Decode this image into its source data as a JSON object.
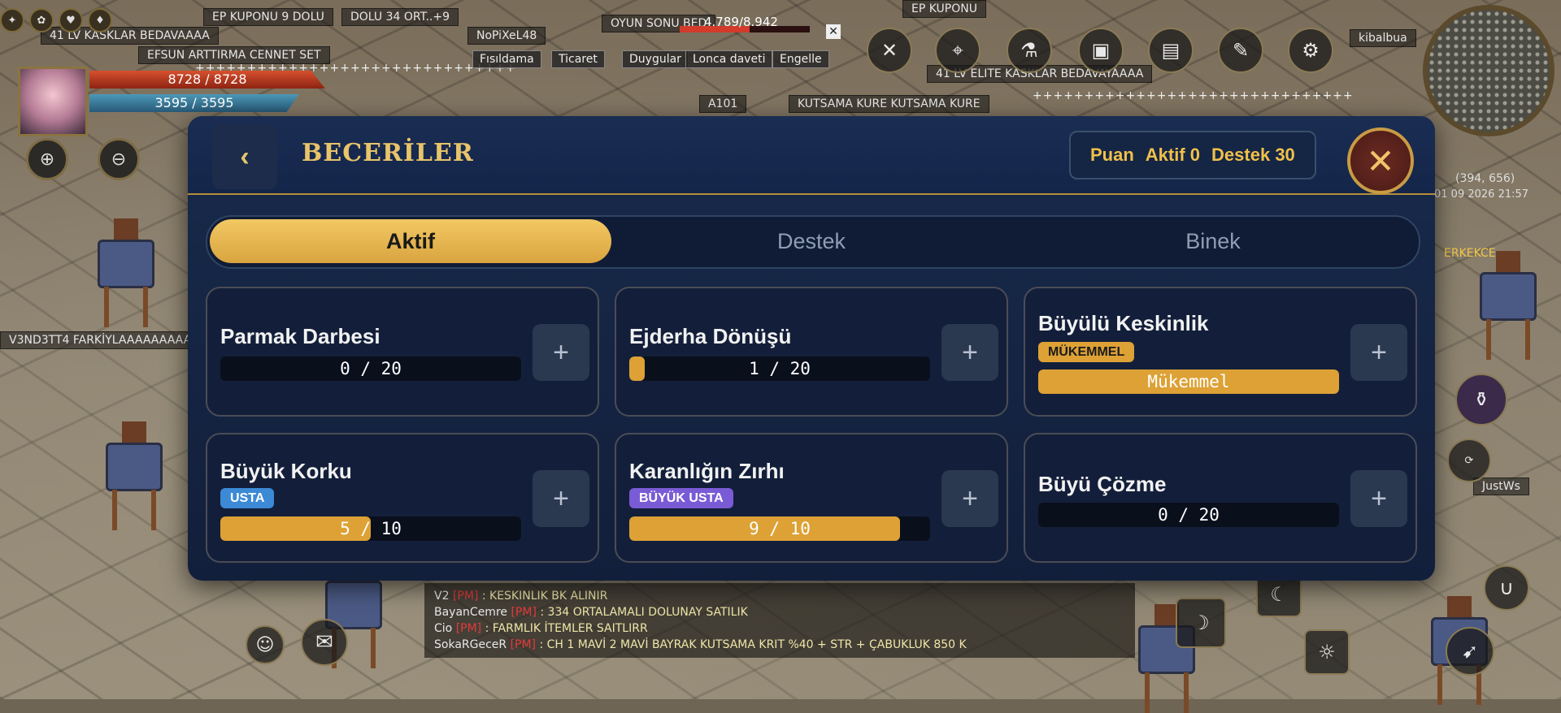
{
  "world": {
    "tags": [
      "41 LV KASKLAR BEDAVAAAA",
      "EFSUN ARTTIRMA CENNET SET",
      "EP KUPONU 9 DOLU",
      "DOLU 34 ORT..+9",
      "41 LV ELITE KASKLAR BEDAVAYAAAA",
      "KUTSAMA KURE KUTSAMA KURE",
      "A101",
      "NoPiXeL48",
      "OYUN SONU BED",
      "V3ND3TT4 FARKİYLAAAAAAAAAA",
      "JustWs",
      "kibalbua",
      "EP KUPONU",
      "ERKEKCE"
    ],
    "ticker": "+++++++++++++++++++++++++++++++",
    "target_hp": "4.789/8.942",
    "coordinates": "(394, 656)",
    "datetime": "01 09 2026 21:57"
  },
  "hud": {
    "hp": "8728 / 8728",
    "mp": "3595 / 3595",
    "chat_buttons": [
      "Fısıldama",
      "Ticaret",
      "Duygular",
      "Lonca daveti",
      "Engelle"
    ]
  },
  "chat": [
    {
      "name": "V2",
      "pm": "[PM]",
      "msg": ": KESKINLIK BK ALINIR"
    },
    {
      "name": "BayanCemre",
      "pm": "[PM]",
      "msg": ": 334 ORTALAMALI DOLUNAY SATILIK"
    },
    {
      "name": "Cio",
      "pm": "[PM]",
      "msg": ": FARMLIK İTEMLER SAITLIRR"
    },
    {
      "name": "SokaRGeceR",
      "pm": "[PM]",
      "msg": ": CH 1 MAVİ 2 MAVİ BAYRAK KUTSAMA KRIT %40 + STR + ÇABUKLUK 850 K"
    }
  ],
  "skills": {
    "title": "BECERİLER",
    "points": {
      "label": "Puan",
      "active": "Aktif 0",
      "support": "Destek 30"
    },
    "tabs": [
      "Aktif",
      "Destek",
      "Binek"
    ],
    "active_tab": "Aktif",
    "cards": [
      {
        "name": "Parmak Darbesi",
        "badge": "",
        "progress": "0  /  20",
        "fill": 0
      },
      {
        "name": "Ejderha Dönüşü",
        "badge": "",
        "progress": "1  /  20",
        "fill": 0.05
      },
      {
        "name": "Büyülü Keskinlik",
        "badge": "MÜKEMMEL",
        "badge_color": "#dda135",
        "progress": "Mükemmel",
        "fill": 1
      },
      {
        "name": "Büyük Korku",
        "badge": "USTA",
        "badge_color": "#3c8ad6",
        "progress": "5  /  10",
        "fill": 0.5
      },
      {
        "name": "Karanlığın Zırhı",
        "badge": "BÜYÜK USTA",
        "badge_color": "#7a5bd6",
        "progress": "9  /  10",
        "fill": 0.9
      },
      {
        "name": "Büyü Çözme",
        "badge": "",
        "progress": "0  /  20",
        "fill": 0
      }
    ],
    "plus_label": "+",
    "back_label": "‹",
    "close_label": "✕"
  },
  "colors": {
    "accent_gold": "#e8c46a",
    "panel_bg": "#162846",
    "progress_fill": "#dda135"
  }
}
